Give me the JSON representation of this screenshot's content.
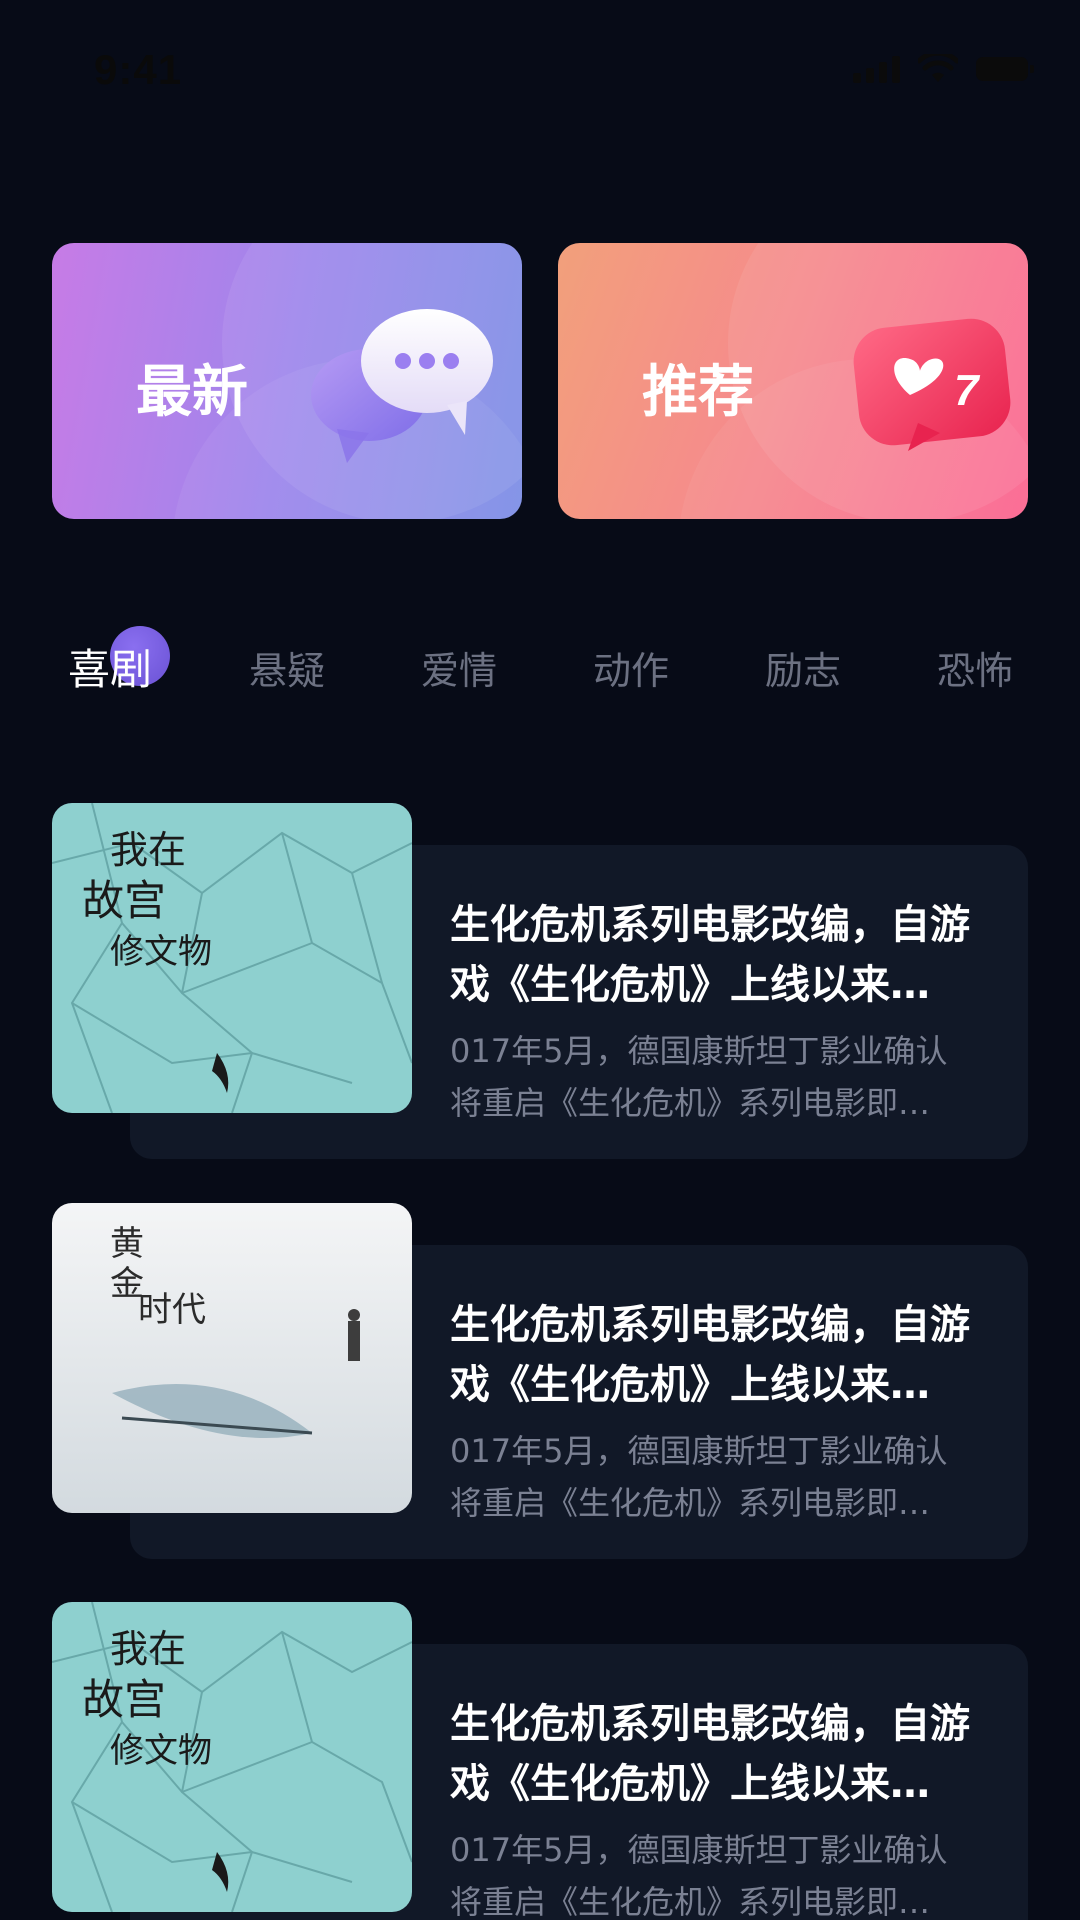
{
  "status_bar": {
    "time": "9:41",
    "icons": [
      "signal-icon",
      "wifi-icon",
      "battery-icon"
    ]
  },
  "cards": [
    {
      "label": "最新",
      "icon": "chat-bubbles-icon"
    },
    {
      "label": "推荐",
      "icon": "heart-badge-icon",
      "badge_count": "7"
    }
  ],
  "tabs": [
    "喜剧",
    "悬疑",
    "爱情",
    "动作",
    "励志",
    "恐怖"
  ],
  "active_tab": "喜剧",
  "list": [
    {
      "poster": "poster-gugong",
      "title_line1": "生化危机系列电影改编，自游",
      "title_line2": "戏《生化危机》上线以来…",
      "desc_line1": "017年5月，德国康斯坦丁影业确认",
      "desc_line2": "将重启《生化危机》系列电影即…"
    },
    {
      "poster": "poster-huangjin",
      "title_line1": "生化危机系列电影改编，自游",
      "title_line2": "戏《生化危机》上线以来…",
      "desc_line1": "017年5月，德国康斯坦丁影业确认",
      "desc_line2": "将重启《生化危机》系列电影即…"
    },
    {
      "poster": "poster-gugong",
      "title_line1": "生化危机系列电影改编，自游",
      "title_line2": "戏《生化危机》上线以来…",
      "desc_line1": "017年5月，德国康斯坦丁影业确认",
      "desc_line2": "将重启《生化危机》系列电影即…"
    }
  ],
  "colors": {
    "background": "#070b17",
    "card_latest_start": "#c77be6",
    "card_latest_end": "#7d8fe6",
    "card_recommend_start": "#f2a07b",
    "card_recommend_end": "#fb6590",
    "tab_active": "#ffffff",
    "tab_inactive": "#6c7182",
    "tab_indicator": "#6a52d4"
  }
}
